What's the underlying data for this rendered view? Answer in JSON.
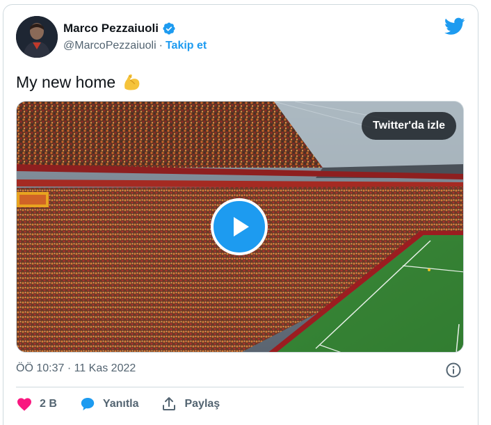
{
  "author": {
    "name": "Marco Pezzaiuoli",
    "handle": "@MarcoPezzaiuoli",
    "separator": "·",
    "follow_label": "Takip et",
    "verified": true
  },
  "tweet": {
    "text": "My new home",
    "emoji": "flexed-biceps"
  },
  "media": {
    "watch_label": "Twitter'da izle",
    "type": "video"
  },
  "meta": {
    "timestamp": "ÖÖ 10:37 · 11 Kas 2022"
  },
  "actions": {
    "like_count": "2 B",
    "reply_label": "Yanıtla",
    "share_label": "Paylaş"
  },
  "colors": {
    "accent": "#1d9bf0",
    "like": "#f91880",
    "text_secondary": "#536471"
  }
}
